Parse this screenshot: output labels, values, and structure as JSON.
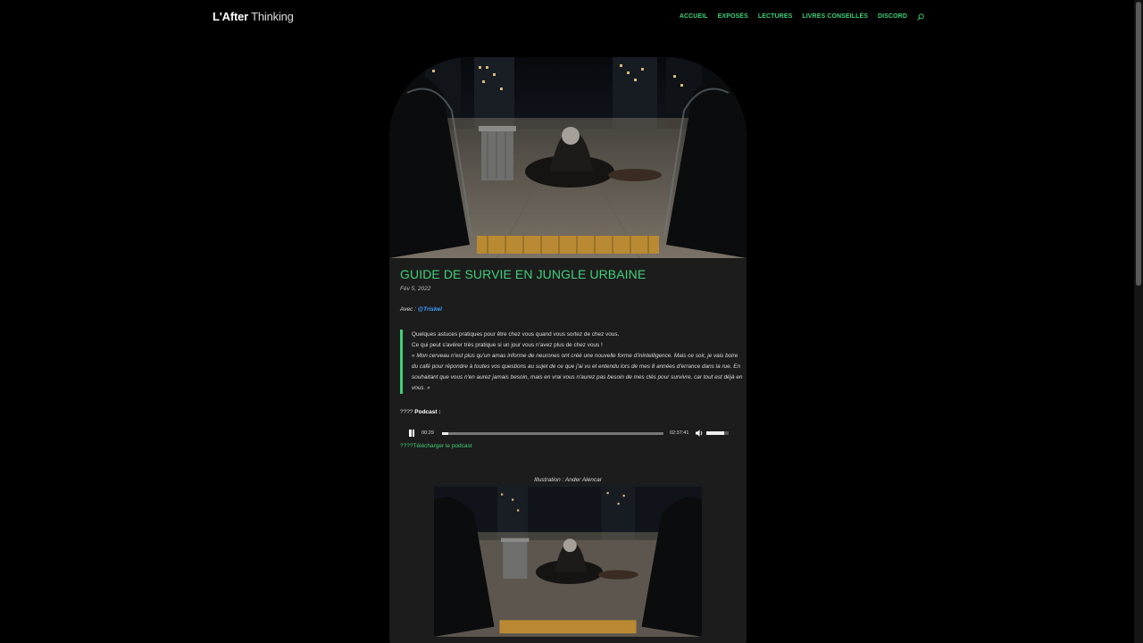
{
  "header": {
    "logo_bold": "L'After",
    "logo_light": "Thinking",
    "nav": [
      "ACCUEIL",
      "EXPOSÉS",
      "LECTURES",
      "LIVRES CONSEILLÉS",
      "DISCORD"
    ]
  },
  "article": {
    "title": "GUIDE DE SURVIE EN JUNGLE URBAINE",
    "date": "Fév 5, 2022",
    "with_label": "Avec :",
    "with_user": "@Triskel",
    "quote_line1": "Quelques astuces pratiques pour être chez vous quand vous sortez de chez vous.",
    "quote_line2": "Ce qui peut s'avérer très pratique si un jour vous n'avez plus de chez vous !",
    "quote_italic": "« Mon cerveau n'est plus qu'un amas informe de neurones ont créé une nouvelle forme d'inintelligence. Mais ce soir, je vais boire du café pour répondre à toutes vos questions au sujet de ce que j'ai vu et entendu lors de mes 8 années d'errance dans la rue. En souhaitant que vous n'en aurez jamais besoin, mais en vrai vous n'aurez pas besoin de mes clés pour survivre, car tout est déjà en vous. »",
    "podcast_prefix": "????",
    "podcast_label": "Podcast :",
    "download_link": "????Télécharger le podcast",
    "illustration_caption": "Illustration : Ander Alencar"
  },
  "player": {
    "current_time": "00:29",
    "total_time": "02:37:41",
    "progress": 0.03,
    "volume": 0.8
  },
  "colors": {
    "accent": "#3fd07a",
    "link_user": "#3aa0ff",
    "card_bg": "#1c1c1c",
    "page_bg": "#000000"
  }
}
